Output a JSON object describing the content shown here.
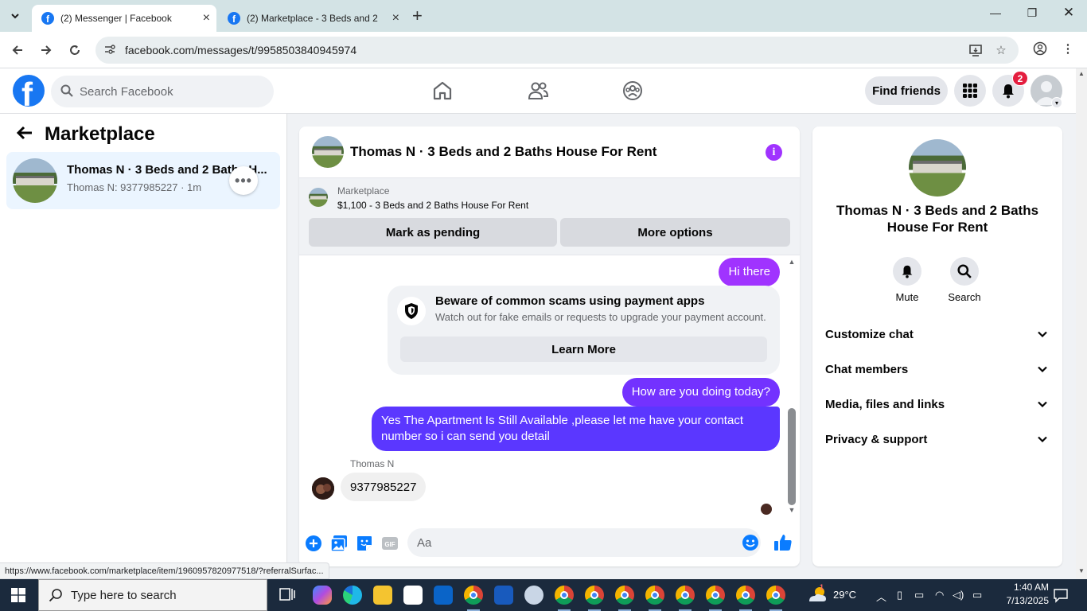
{
  "browser": {
    "tabs": [
      {
        "title": "(2) Messenger | Facebook",
        "active": true
      },
      {
        "title": "(2) Marketplace - 3 Beds and 2 B",
        "active": false
      }
    ],
    "url": "facebook.com/messages/t/9958503840945974",
    "status_url": "https://www.facebook.com/marketplace/item/1960957820977518/?referralSurfac..."
  },
  "header": {
    "search_placeholder": "Search Facebook",
    "find_friends": "Find friends",
    "notification_count": "2",
    "brand_color": "#1877f2"
  },
  "sidebar": {
    "title": "Marketplace",
    "conversation": {
      "name": "Thomas N · 3 Beds and 2 Baths H...",
      "snippet": "Thomas N: 9377985227 · 1m"
    }
  },
  "chat": {
    "title": "Thomas N · 3 Beds and 2 Baths House For Rent",
    "listing": {
      "kicker": "Marketplace",
      "description": "$1,100 - 3 Beds and 2 Baths House For Rent",
      "primary_button": "Mark as pending",
      "secondary_button": "More options"
    },
    "messages": {
      "m1": "Hi there",
      "warning_title": "Beware of common scams using payment apps",
      "warning_body": "Watch out for fake emails or requests to upgrade your payment account.",
      "warning_button": "Learn More",
      "m2": "How are you doing today?",
      "m3": "Yes The Apartment Is Still Available ,please let me have your contact number so i can send you detail",
      "sender": "Thomas N",
      "m4": "9377985227"
    },
    "composer_placeholder": "Aa",
    "accent_color": "#a033ff"
  },
  "info_panel": {
    "name": "Thomas N · 3 Beds and 2 Baths House For Rent",
    "actions": [
      "Mute",
      "Search"
    ],
    "sections": [
      "Customize chat",
      "Chat members",
      "Media, files and links",
      "Privacy & support"
    ]
  },
  "taskbar": {
    "search_text": "Type here to search",
    "weather": "29°C",
    "time": "1:40 AM",
    "date": "7/13/2025",
    "weather_badge": "1"
  }
}
